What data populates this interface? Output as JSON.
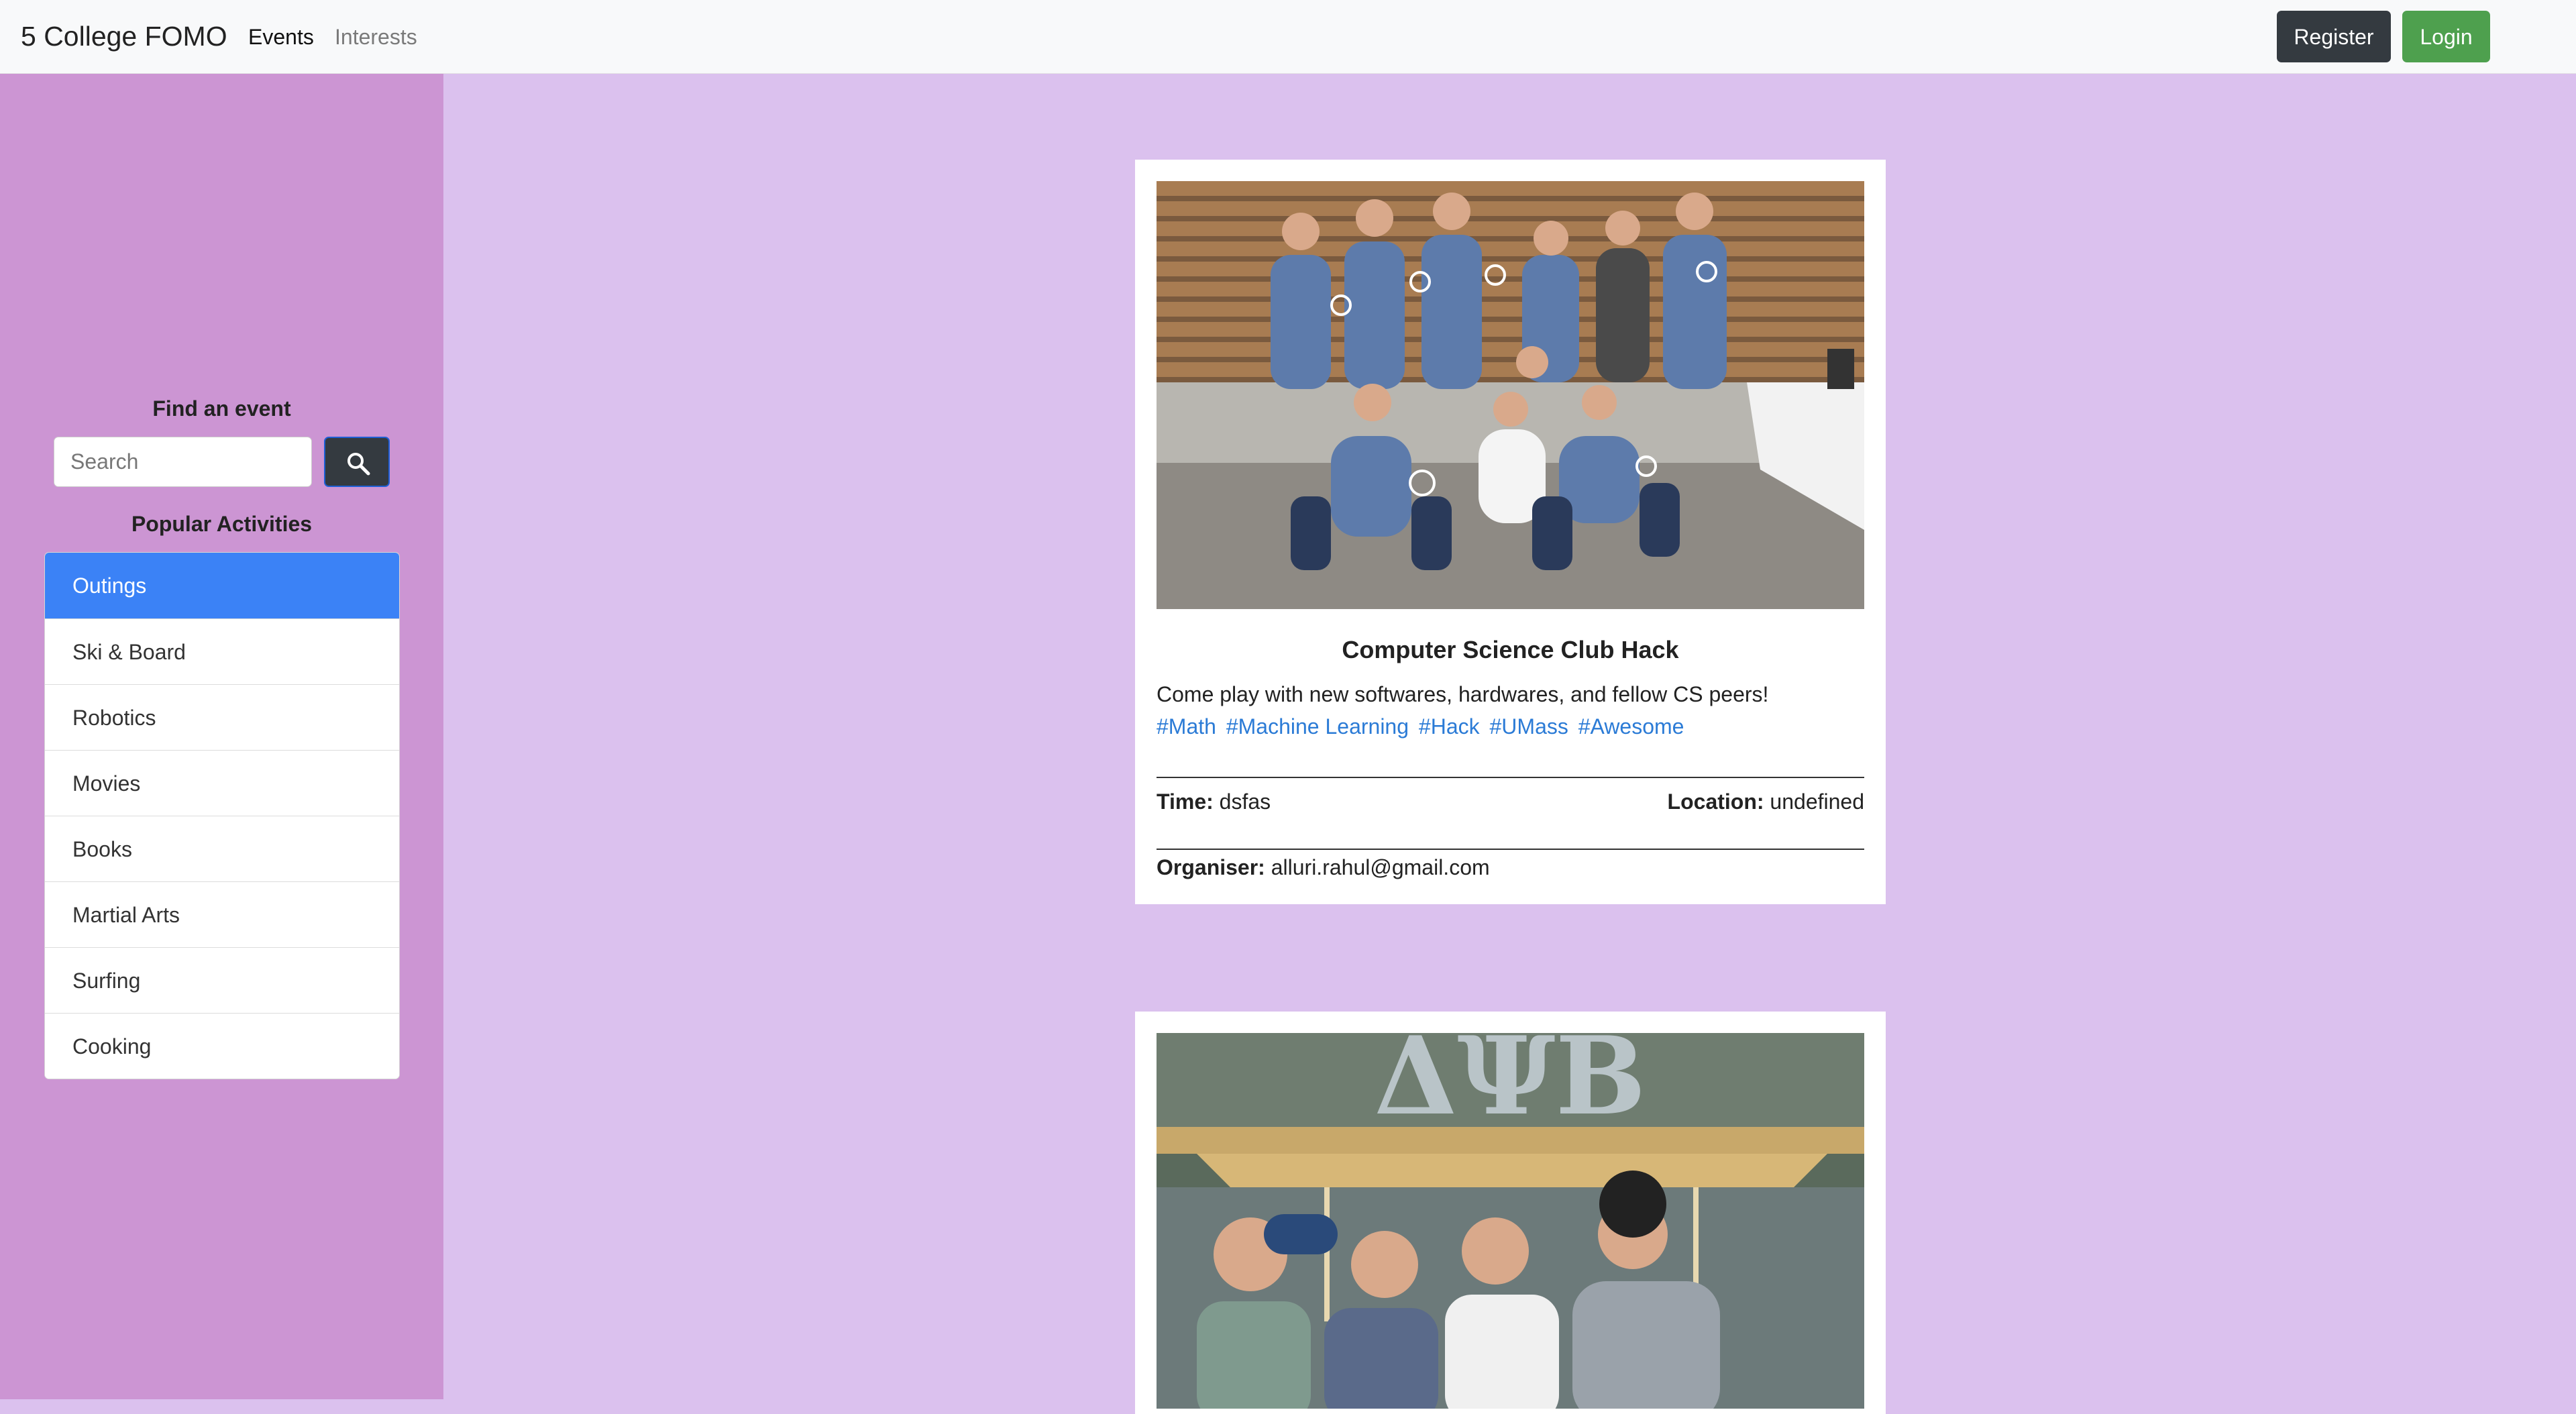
{
  "navbar": {
    "brand": "5 College FOMO",
    "links": [
      {
        "label": "Events"
      },
      {
        "label": "Interests"
      }
    ],
    "register_label": "Register",
    "login_label": "Login"
  },
  "sidebar": {
    "find_title": "Find an event",
    "search": {
      "placeholder": "Search",
      "value": ""
    },
    "search_icon": "search-icon",
    "popular_title": "Popular Activities",
    "activities": [
      {
        "label": "Outings",
        "active": true
      },
      {
        "label": "Ski & Board"
      },
      {
        "label": "Robotics"
      },
      {
        "label": "Movies"
      },
      {
        "label": "Books"
      },
      {
        "label": "Martial Arts"
      },
      {
        "label": "Surfing"
      },
      {
        "label": "Cooking"
      }
    ]
  },
  "events": [
    {
      "title": "Computer Science Club Hack",
      "description": "Come play with new softwares, hardwares, and fellow CS peers!",
      "tags": [
        "#Math",
        "#Machine Learning",
        "#Hack",
        "#UMass",
        "#Awesome"
      ],
      "time_label": "Time:",
      "time": "dsfas",
      "location_label": "Location:",
      "location": "undefined",
      "organiser_label": "Organiser:",
      "organiser": "alluri.rahul@gmail.com"
    },
    {
      "photo_caption": "ΔΨB"
    }
  ],
  "colors": {
    "accent": "#3b82f6",
    "sidebar_bg": "#cc95d3",
    "main_bg": "#dbc1ee",
    "tag": "#2b7bd6",
    "register_btn": "#343a40",
    "login_btn": "#4ea04e"
  }
}
